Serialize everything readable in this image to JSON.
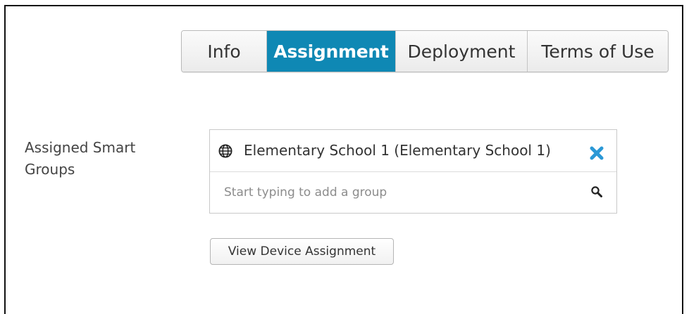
{
  "tabs": [
    {
      "label": "Info",
      "active": false
    },
    {
      "label": "Assignment",
      "active": true
    },
    {
      "label": "Deployment",
      "active": false
    },
    {
      "label": "Terms of Use",
      "active": false
    }
  ],
  "assigned_groups": {
    "label_line1": "Assigned Smart",
    "label_line2": "Groups",
    "items": [
      {
        "name": "Elementary School 1 (Elementary School 1)",
        "icon": "globe-icon",
        "remove_icon": "close-icon"
      }
    ],
    "search": {
      "value": "",
      "placeholder": "Start typing to add a group",
      "icon": "search-icon"
    }
  },
  "buttons": {
    "view_device_assignment": "View Device Assignment"
  },
  "colors": {
    "active_tab": "#0f88b4",
    "remove_icon": "#2a98d6"
  }
}
